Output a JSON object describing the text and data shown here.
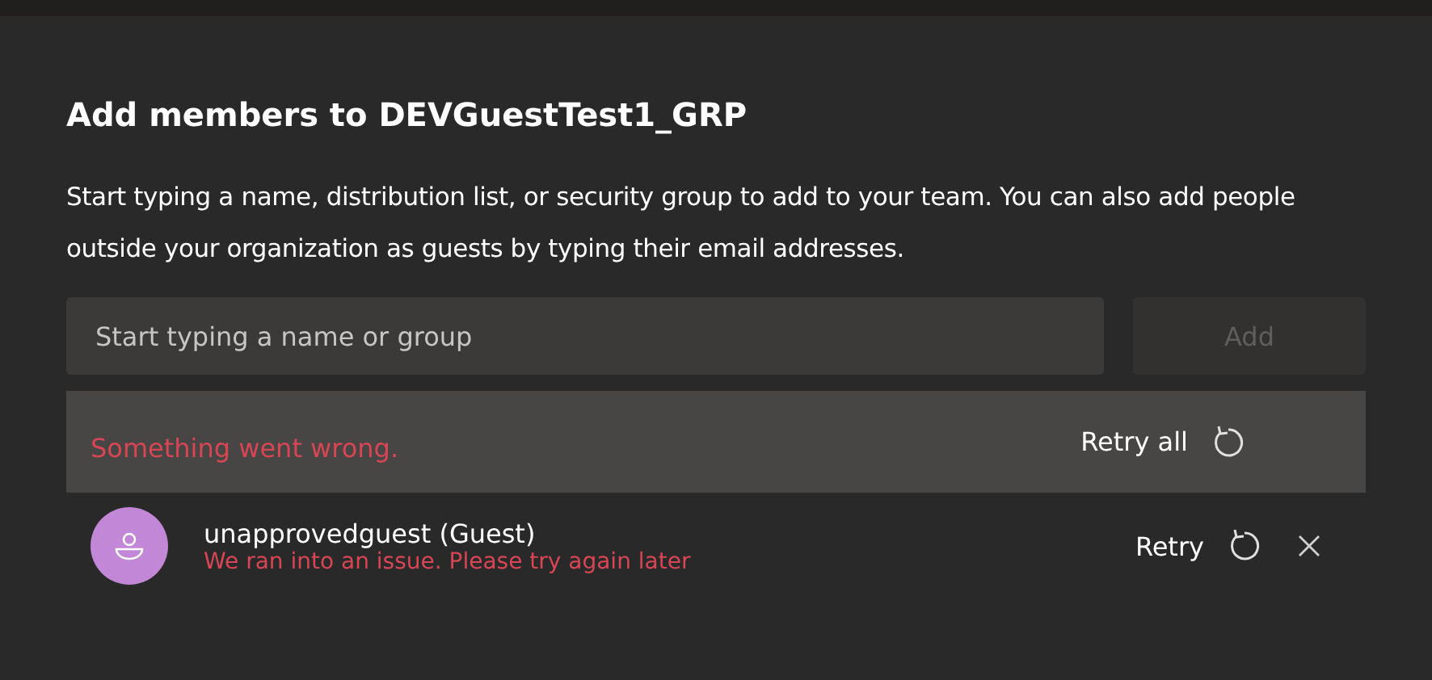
{
  "dialog": {
    "title": "Add members to DEVGuestTest1_GRP",
    "description": "Start typing a name, distribution list, or security group to add to your team. You can also add people outside your organization as guests by typing their email addresses."
  },
  "search": {
    "placeholder": "Start typing a name or group"
  },
  "add_button": {
    "label": "Add",
    "disabled": true
  },
  "error_banner": {
    "message": "Something went wrong.",
    "action": "Retry all"
  },
  "members": [
    {
      "name": "unapprovedguest (Guest)",
      "error": "We ran into an issue. Please try again later",
      "action": "Retry"
    }
  ]
}
